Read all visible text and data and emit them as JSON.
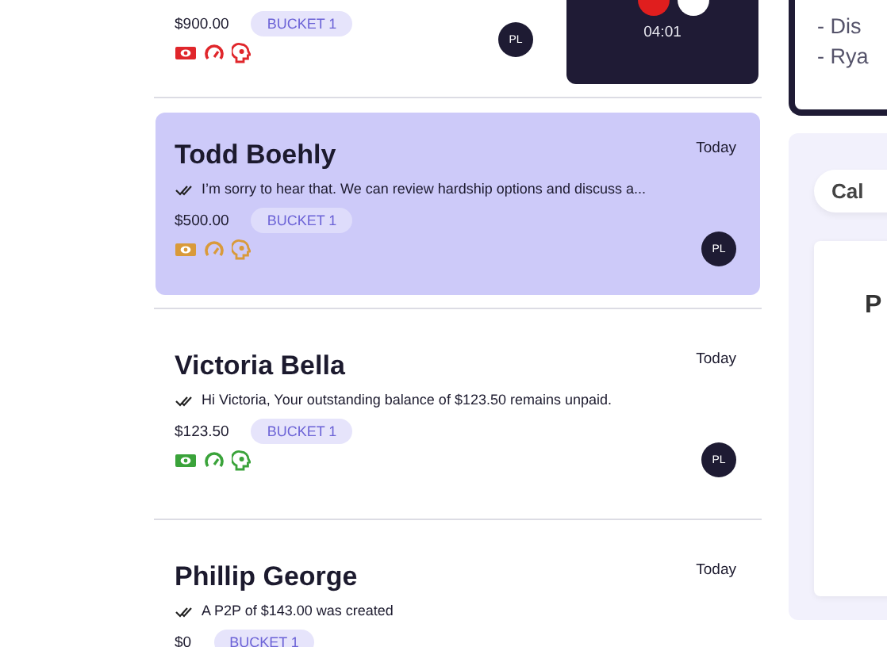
{
  "conversations": [
    {
      "kind": "partial",
      "selected": false,
      "amount": "$900.00",
      "bucket": "BUCKET 1",
      "color": "#e0262b",
      "avatar": "PL",
      "call": {
        "timer": "04:01"
      }
    },
    {
      "kind": "full",
      "selected": true,
      "name": "Todd Boehly",
      "date": "Today",
      "message": "I’m sorry to hear that. We can review hardship options and discuss a...",
      "amount": "$500.00",
      "bucket": "BUCKET 1",
      "color": "#d99a3a",
      "avatar": "PL"
    },
    {
      "kind": "full",
      "selected": false,
      "name": "Victoria Bella",
      "date": "Today",
      "message": "Hi Victoria, Your outstanding balance of $123.50 remains unpaid.",
      "amount": "$123.50",
      "bucket": "BUCKET 1",
      "color": "#3aa33a",
      "avatar": "PL"
    },
    {
      "kind": "full",
      "selected": false,
      "name": "Phillip George",
      "date": "Today",
      "message": "A P2P of $143.00 was created",
      "amount": "$0",
      "bucket": "BUCKET 1"
    }
  ],
  "notes": {
    "lines": [
      "- Dis",
      "- Rya"
    ]
  },
  "panel": {
    "tab": "Cal",
    "heading": "P"
  }
}
